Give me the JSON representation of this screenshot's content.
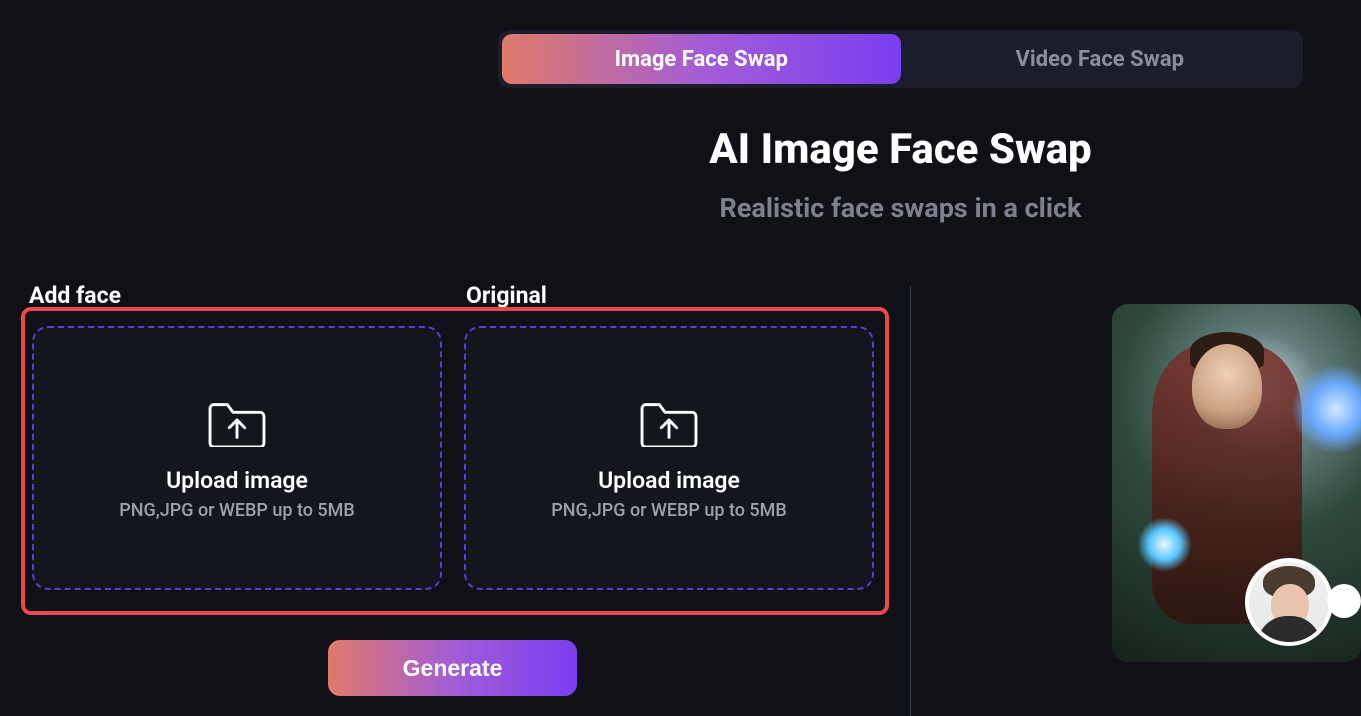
{
  "tabs": {
    "image": "Image Face Swap",
    "video": "Video Face Swap"
  },
  "heading": {
    "title": "AI Image Face Swap",
    "subtitle": "Realistic face swaps in a click"
  },
  "upload": {
    "addface_label": "Add face",
    "original_label": "Original",
    "drop_title": "Upload image",
    "drop_hint": "PNG,JPG or WEBP up to 5MB"
  },
  "actions": {
    "generate": "Generate"
  }
}
